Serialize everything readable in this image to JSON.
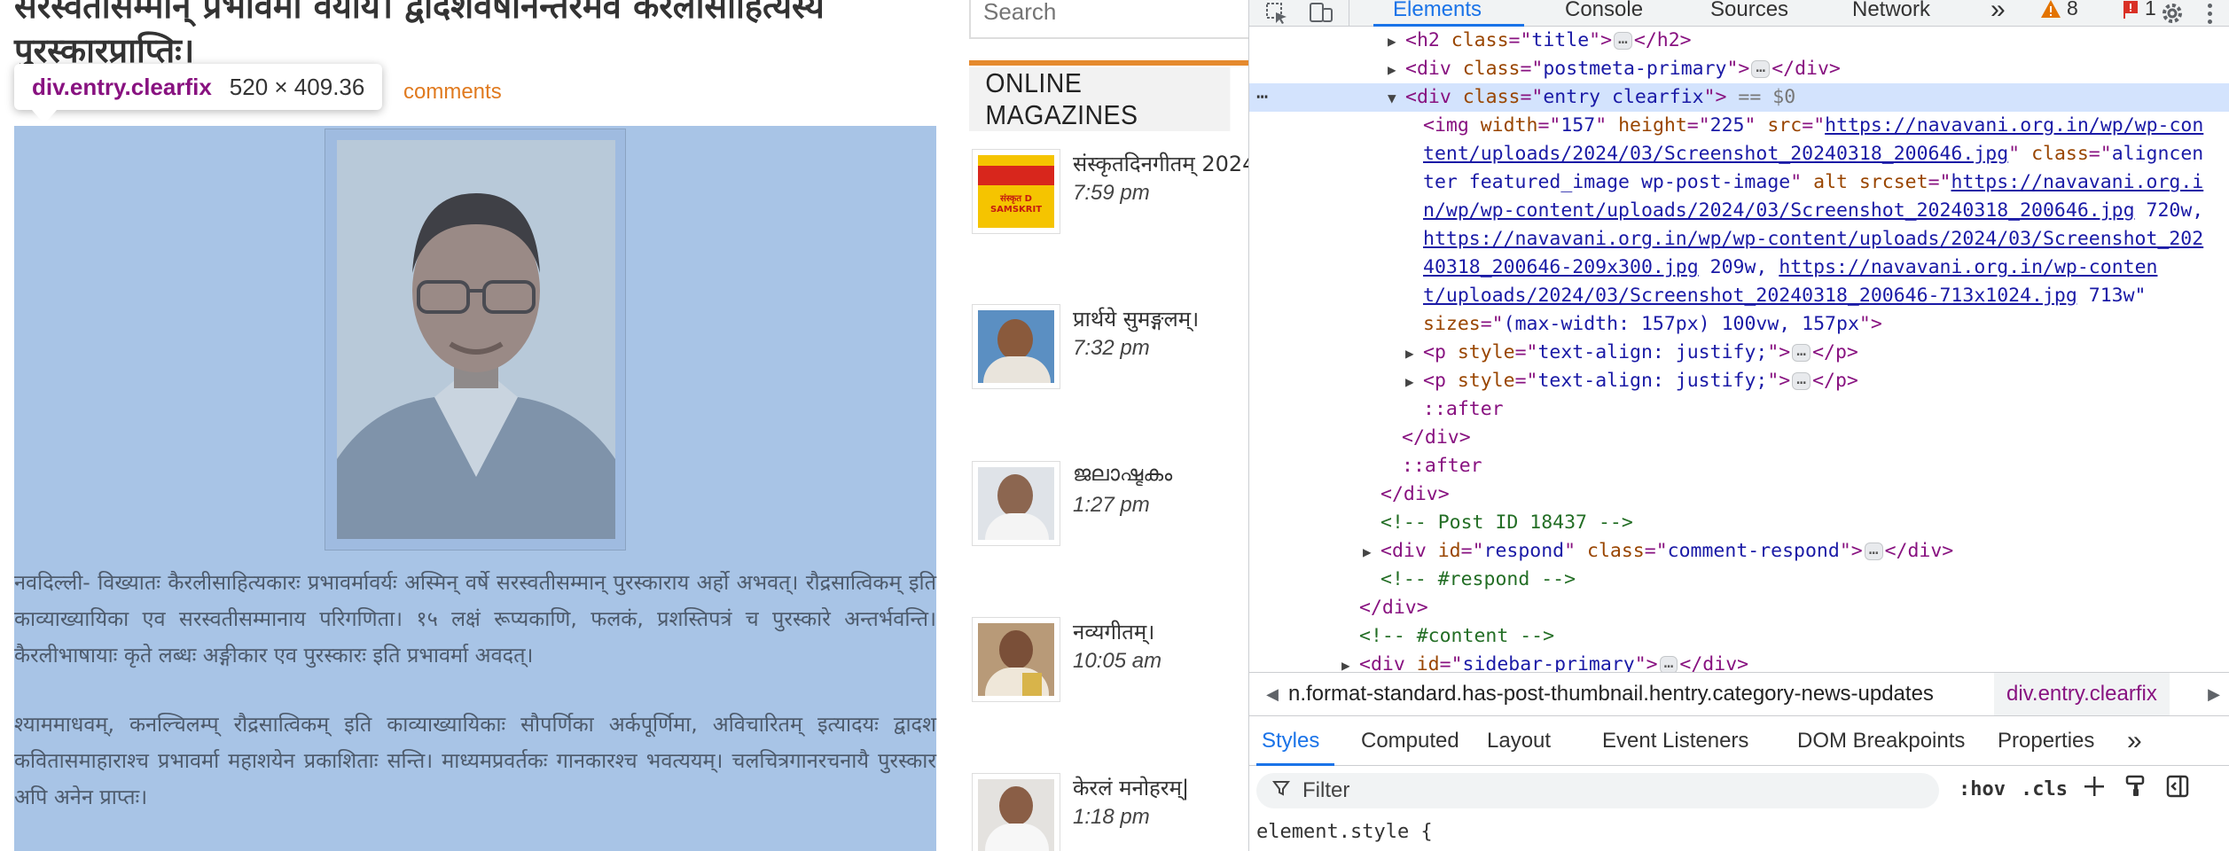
{
  "page": {
    "post_title": "सरस्वतीसम्मान् प्रभावर्मा वर्याय। द्वादशवर्षानन्तरमेव कैरलीसाहित्यस्य पुरस्कारप्राप्तिः।",
    "comments_link": "comments",
    "tooltip": {
      "selector": "div.entry.clearfix",
      "size": "520 × 409.36"
    },
    "paragraph1": "नवदिल्ली- विख्यातः कैरलीसाहित्यकारः प्रभावर्मावर्यः अस्मिन् वर्षे सरस्वतीसम्मान् पुरस्काराय अर्हो अभवत्। रौद्रसात्विकम् इति काव्याख्यायिका एव सरस्वतीसम्मानाय परिगणिता। १५ लक्षं रूप्यकाणि, फलकं, प्रशस्तिपत्रं च पुरस्कारे अन्तर्भवन्ति। कैरलीभाषायाः कृते लब्धः अङ्गीकार एव पुरस्कारः इति प्रभावर्मा अवदत्।",
    "paragraph2": "श्याममाधवम्, कनल्चिलम्प् रौद्रसात्विकम् इति काव्याख्यायिकाः सौपर्णिका अर्कपूर्णिमा, अविचारितम् इत्यादयः द्वादश कवितासमाहाराश्च प्रभावर्मा महाशयेन प्रकाशिताः सन्ति। माध्यमप्रवर्तकः गानकारश्च भवत्ययम्। चलचित्रगानरचनायै पुरस्कार अपि अनेन प्राप्तः।",
    "sidebar": {
      "search_placeholder": "Search",
      "widget_title": "ONLINE MAGAZINES",
      "thumb1_text": "संस्कृत D SAMSKRIT",
      "items": [
        {
          "title": "संस्कृतदिनगीतम् 2024",
          "time": "7:59 pm"
        },
        {
          "title": "प्रार्थये सुमङ्गलम्।",
          "time": "7:32 pm"
        },
        {
          "title": "ജലാഷ്ടകം",
          "time": "1:27 pm"
        },
        {
          "title": "नव्यगीतम्।",
          "time": "10:05 am"
        },
        {
          "title": "केरलं मनोहरम्|",
          "time": "1:18 pm"
        }
      ]
    }
  },
  "devtools": {
    "tabs": [
      "Elements",
      "Console",
      "Sources",
      "Network"
    ],
    "more_tabs": "»",
    "warnings": "8",
    "errors": "1",
    "dom": {
      "h2_class": "title",
      "postmeta_class": "postmeta-primary",
      "entry_class": "entry clearfix",
      "selected_marker": "== $0",
      "img_width": "157",
      "img_height": "225",
      "img_src_1": "https://navavani.org.in/wp/wp-con",
      "img_src_2": "tent/uploads/2024/03/Screenshot_20240318_200646.jpg",
      "img_class_1": "aligncen",
      "img_class_2": "ter featured_image wp-post-image",
      "srcset_1": "https://navavani.org.i",
      "srcset_2": "n/wp/wp-content/uploads/2024/03/Screenshot_20240318_200646.jpg",
      "srcset_2w": "720w,",
      "srcset_3": "https://navavani.org.in/wp/wp-content/uploads/2024/03/Screenshot_202",
      "srcset_4": "40318_200646-209x300.jpg",
      "srcset_4w": "209w,",
      "srcset_4b": "https://navavani.org.in/wp-conten",
      "srcset_5": "t/uploads/2024/03/Screenshot_20240318_200646-713x1024.jpg",
      "srcset_5w": "713w\"",
      "sizes": "(max-width: 157px) 100vw, 157px",
      "p_style": "text-align: justify;",
      "after": "::after",
      "comment_post": "<!-- Post ID 18437 -->",
      "respond_id": "respond",
      "respond_class": "comment-respond",
      "comment_respond": "<!-- #respond -->",
      "comment_content": "<!-- #content -->",
      "sidebar_id": "sidebar-primary"
    },
    "breadcrumb": {
      "path": "n.format-standard.has-post-thumbnail.hentry.category-news-updates",
      "current": "div.entry.clearfix"
    },
    "sub_tabs": [
      "Styles",
      "Computed",
      "Layout",
      "Event Listeners",
      "DOM Breakpoints",
      "Properties"
    ],
    "filter_placeholder": "Filter",
    "hov": ":hov",
    "cls": ".cls",
    "element_style": "element.style {"
  }
}
